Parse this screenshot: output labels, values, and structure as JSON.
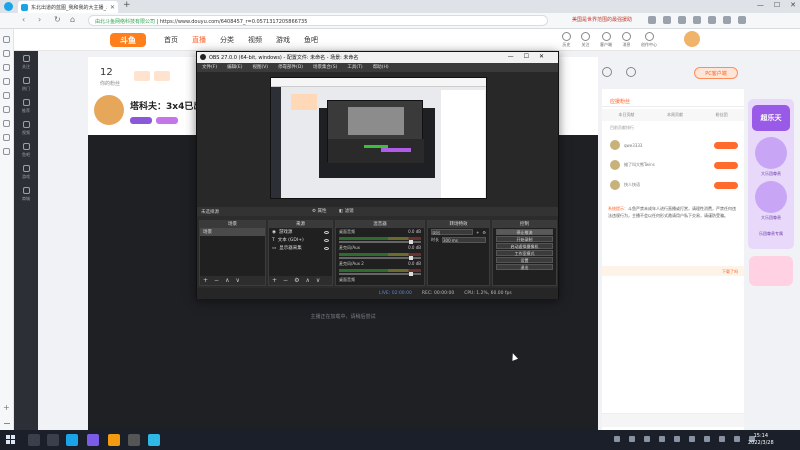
{
  "browser": {
    "tab_title": "东北出道的蓝图_我和我的大主播_斗",
    "url_security": "由北斗鱼网络科技有限公司",
    "url": "https://www.douyu.com/6408457_r=0.0571317205866735",
    "recommend_note": "美国是世界范围的最强援助"
  },
  "douyu": {
    "logo": "斗鱼",
    "menu": [
      "首页",
      "直播",
      "分类",
      "视频",
      "游戏",
      "鱼吧"
    ],
    "menu_active_index": 1,
    "top_icons": [
      "历史",
      "关注",
      "客户端",
      "消息",
      "创作中心"
    ],
    "sidebar": [
      "关注",
      "热门",
      "推荐",
      "视频",
      "鱼吧",
      "游戏",
      "商城"
    ],
    "room": {
      "count": "12",
      "count_label": "你的粉丝",
      "title": "塔科夫：3x4已出 乌",
      "player_hint": "主播正在加载中，请稍后尝试"
    },
    "right": {
      "pc_button": "PC客户端",
      "section_title": "应援粉丝",
      "tabs": [
        "本日贡献",
        "本周贡献",
        "粉丝团"
      ],
      "rank_note": "目前贡献排行",
      "fans": [
        "qwe3333",
        "蜡了叫大熊Twins",
        "快人快语"
      ],
      "notice_prefix": "系统提示：",
      "notice": "斗鱼严禁未成年人进行直播或打赏，请理性消费，严禁任何违法违规行为，主播不会以任何形式邀请用户私下交易，请谨防受骗。",
      "footer_action": "下载了吗",
      "promo_title": "超乐天",
      "promo_labels": [
        "大乐团尊贵",
        "大乐团尊贵",
        "乐团尊贵专属"
      ]
    }
  },
  "obs": {
    "title": "OBS 27.0.0 (64-bit, windows) - 配置文件: 未命名 - 场景: 未命名",
    "menu": [
      "文件(F)",
      "编辑(E)",
      "视图(V)",
      "停靠部件(D)",
      "场景集合(S)",
      "工具(T)",
      "帮助(H)"
    ],
    "selection_note": "未选择源",
    "properties_label": "属性",
    "filters_label": "滤镜",
    "docks": {
      "scenes": {
        "title": "场景",
        "items": [
          "场景"
        ]
      },
      "sources": {
        "title": "来源",
        "items": [
          "游戏源",
          "文本 (GDI+)",
          "显示器采集"
        ]
      },
      "mixer": {
        "title": "混音器",
        "channels": [
          {
            "name": "桌面音频",
            "level": "0.0 dB"
          },
          {
            "name": "麦克风/Aux",
            "level": "0.0 dB"
          },
          {
            "name": "麦克风/Aux 2",
            "level": "0.0 dB"
          }
        ],
        "extra": "桌面音频"
      },
      "transitions": {
        "title": "转场特效",
        "mode": "淡出",
        "duration_label": "时长",
        "duration": "300 ms"
      },
      "controls": {
        "title": "控制",
        "buttons": [
          "停止推流",
          "开始录制",
          "启动虚拟摄像机",
          "工作室模式",
          "设置",
          "退出"
        ]
      }
    },
    "status": {
      "live_label": "LIVE: 02:00:00",
      "rec_label": "REC: 00:00:00",
      "cpu": "CPU: 1.2%, 60.00 fps"
    }
  },
  "taskbar": {
    "time": "15:14",
    "date": "2022/3/28"
  }
}
